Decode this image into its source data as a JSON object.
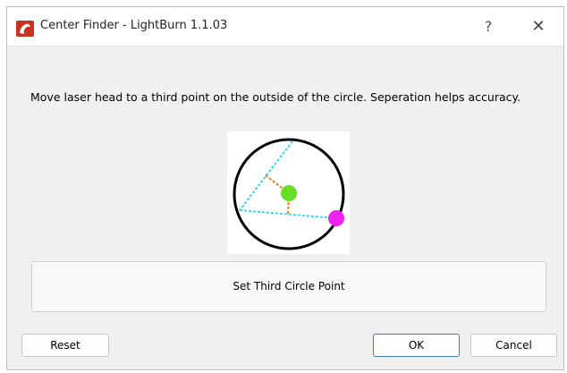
{
  "window": {
    "title": "Center Finder - LightBurn 1.1.03",
    "help_label": "?",
    "close_label": "✕"
  },
  "instruction_text": "Move laser head to a third point on the outside of the circle.  Seperation helps accuracy.",
  "diagram": {
    "circle_color": "#000000",
    "chord_color": "#33d6f0",
    "bisector_color": "#f07a1a",
    "center_color": "#66dd22",
    "third_point_color": "#ee22ee"
  },
  "buttons": {
    "set_point_label": "Set Third Circle Point",
    "reset_label": "Reset",
    "ok_label": "OK",
    "cancel_label": "Cancel"
  }
}
